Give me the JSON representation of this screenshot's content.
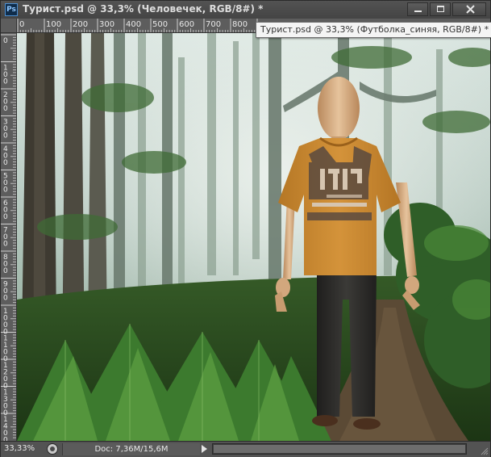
{
  "window": {
    "app_badge": "Ps",
    "title": "Турист.psd @ 33,3% (Человечек, RGB/8#) *"
  },
  "icons": {
    "app": "photoshop-logo",
    "minimize": "minimize-icon",
    "maximize": "maximize-icon",
    "close": "close-icon",
    "status": "proof-setup-icon",
    "status_arrow": "right-triangle-icon",
    "grip": "resize-grip-icon"
  },
  "rulers": {
    "top_labels": [
      "0",
      "100",
      "200",
      "300",
      "400",
      "500",
      "600",
      "700",
      "800"
    ],
    "left_labels": [
      "0",
      "100",
      "200",
      "300",
      "400",
      "500",
      "600",
      "700",
      "800",
      "900",
      "1000",
      "1100",
      "1200",
      "1300",
      "1400"
    ]
  },
  "tooltip": {
    "text": "Турист.psd @ 33,3% (Футболка_синяя, RGB/8#) *"
  },
  "status": {
    "zoom": "33,33%",
    "doc_info": "Doc: 7,36M/15,6M"
  },
  "colors": {
    "tshirt": "#c9872e",
    "pants": "#2d2c2a",
    "wood": "#d8ae84",
    "ui_dark": "#474747"
  }
}
